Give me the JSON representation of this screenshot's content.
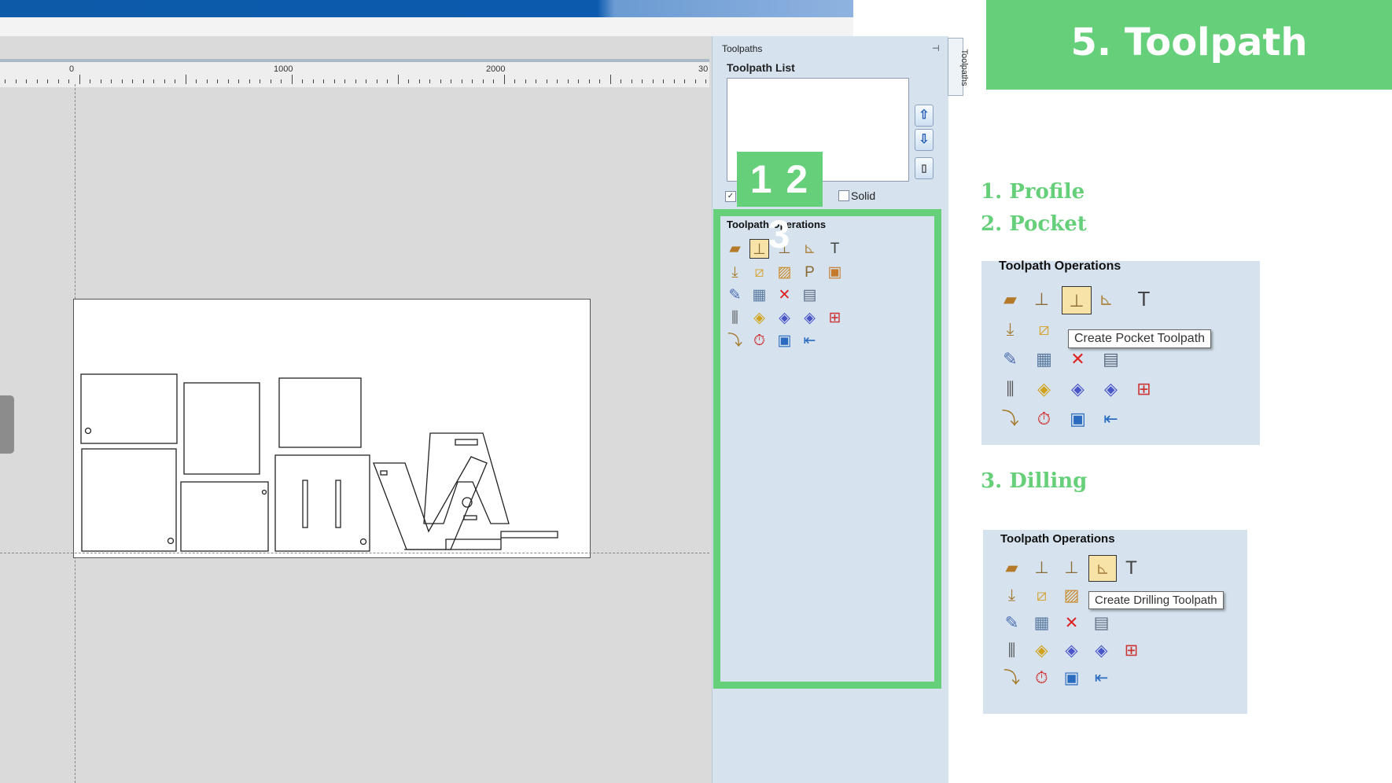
{
  "window": {
    "buttons": [
      "–",
      "▫",
      "✕"
    ],
    "mdi_buttons": [
      "–",
      "⧉",
      "✕"
    ]
  },
  "ruler": {
    "labels": [
      "0",
      "1000",
      "2000",
      "30"
    ]
  },
  "toolpaths_panel": {
    "header": "Toolpaths",
    "pin": "⊣",
    "side_tab": "Toolpaths",
    "list_label": "Toolpath List",
    "move_up_icon": "up-arrow-icon",
    "move_down_icon": "down-arrow-icon",
    "solid_label": "Solid",
    "show_checkbox_checked": true,
    "operations_label": "Toolpath Operations",
    "step_numbers": "1 2 3"
  },
  "slide": {
    "title": "5. Toolpath",
    "steps": [
      "1. Profile",
      "2. Pocket",
      "3. Dilling"
    ],
    "pocket_card": {
      "label": "Toolpath Operations",
      "tooltip": "Create Pocket Toolpath"
    },
    "drilling_card": {
      "label": "Toolpath Operations",
      "tooltip": "Create Drilling Toolpath"
    }
  },
  "colors": {
    "accent_green": "#66cf7a",
    "panel_blue": "#d6e3ef",
    "titlebar_blue": "#0b5aae"
  }
}
